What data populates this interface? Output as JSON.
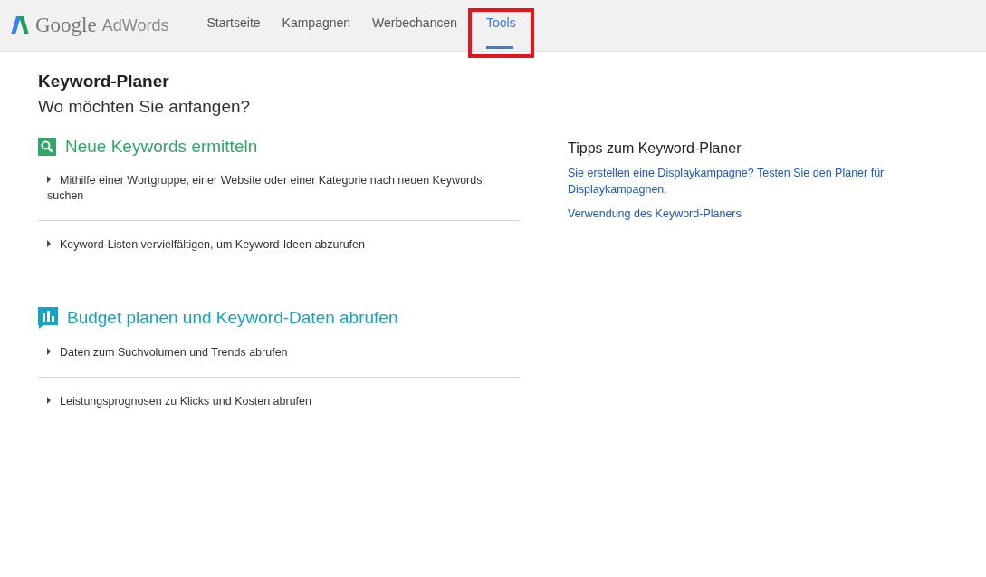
{
  "header": {
    "logo": {
      "brand": "Google",
      "product": "AdWords"
    },
    "tabs": [
      {
        "label": "Startseite",
        "selected": false,
        "highlighted": false
      },
      {
        "label": "Kampagnen",
        "selected": false,
        "highlighted": false
      },
      {
        "label": "Werbechancen",
        "selected": false,
        "highlighted": false
      },
      {
        "label": "Tools",
        "selected": true,
        "highlighted": true
      }
    ]
  },
  "page": {
    "title": "Keyword-Planer",
    "subtitle": "Wo möchten Sie anfangen?"
  },
  "sections": [
    {
      "kind": "search",
      "color": "#2fa667",
      "title": "Neue Keywords ermitteln",
      "items": [
        {
          "label": "Mithilfe einer Wortgruppe, einer Website oder einer Kategorie nach neuen Keywords suchen",
          "expanded": false
        },
        {
          "label": "Keyword-Listen vervielfältigen, um Keyword-Ideen abzurufen",
          "expanded": false
        }
      ]
    },
    {
      "kind": "chart",
      "color": "#13a3c4",
      "title": "Budget planen und Keyword-Daten abrufen",
      "items": [
        {
          "label": "Daten zum Suchvolumen und Trends abrufen",
          "expanded": false
        },
        {
          "label": "Leistungsprognosen zu Klicks und Kosten abrufen",
          "expanded": false
        }
      ]
    }
  ],
  "tips": {
    "title": "Tipps zum Keyword-Planer",
    "links": [
      "Sie erstellen eine Displaykampagne? Testen Sie den Planer für Displaykampagnen.",
      "Verwendung des Keyword-Planers"
    ]
  }
}
